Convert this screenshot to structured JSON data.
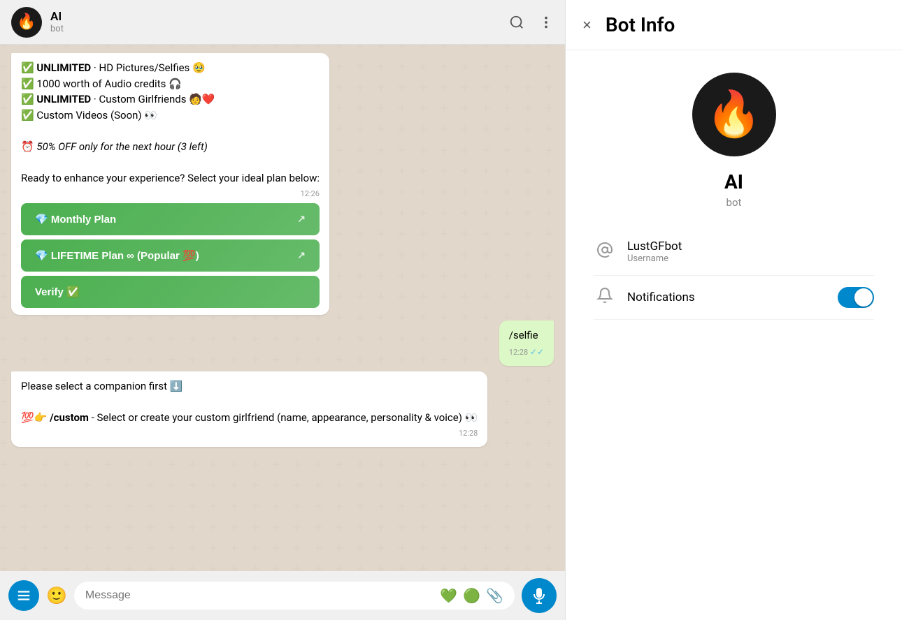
{
  "header": {
    "name": "AI",
    "status": "bot",
    "avatar_emoji": "🔥❤️"
  },
  "chat": {
    "messages": [
      {
        "type": "received",
        "text": "✅ UNLIMITED · HD Pictures/Selfies 🥹\n✅ 1000 worth of Audio credits 🎧\n✅ UNLIMITED · Custom Girlfriends 🧑‍❤️‍\n✅ Custom Videos (Soon) 👀\n\n⏰ 50% OFF only for the next hour (3 left)\n\nReady to enhance your experience? Select your ideal plan below:",
        "time": "12:26"
      },
      {
        "type": "sent",
        "text": "/selfie",
        "time": "12:28",
        "ticks": "✓✓"
      },
      {
        "type": "received",
        "text": "Please select a companion first ⬇️\n\n💯👉 /custom - Select or create your custom girlfriend (name, appearance, personality & voice) 👀",
        "time": "12:28"
      }
    ],
    "buttons": [
      {
        "label": "💎 Monthly Plan",
        "arrow": "↗"
      },
      {
        "label": "💎 LIFETIME Plan ∞ (Popular 💯)",
        "arrow": "↗"
      },
      {
        "label": "Verify ✅",
        "arrow": ""
      }
    ]
  },
  "input": {
    "placeholder": "Message"
  },
  "bot_info": {
    "title": "Bot Info",
    "bot_name": "AI",
    "bot_type": "bot",
    "username_label": "LustGFbot",
    "username_sublabel": "Username",
    "notifications_label": "Notifications",
    "notifications_on": true,
    "close_icon": "×"
  }
}
